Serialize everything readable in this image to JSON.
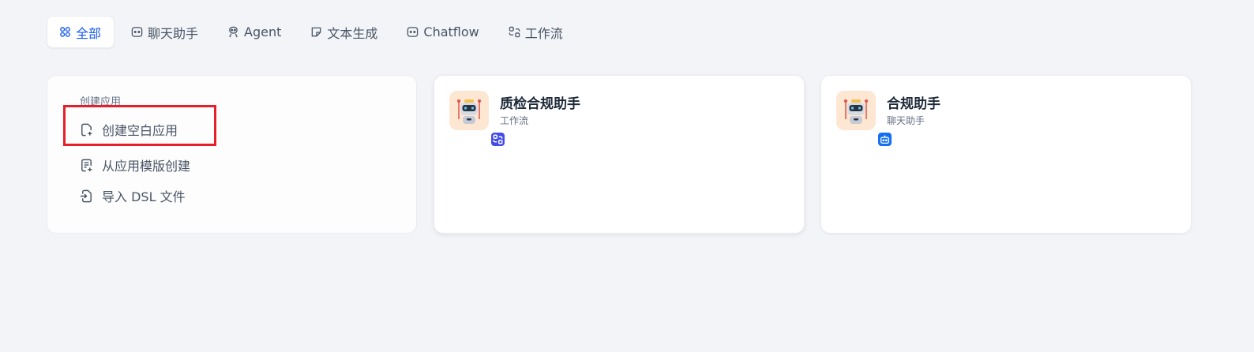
{
  "tabs": [
    {
      "label": "全部",
      "icon": "grid-icon",
      "active": true
    },
    {
      "label": "聊天助手",
      "icon": "chat-bubble-icon",
      "active": false
    },
    {
      "label": "Agent",
      "icon": "agent-icon",
      "active": false
    },
    {
      "label": "文本生成",
      "icon": "document-icon",
      "active": false
    },
    {
      "label": "Chatflow",
      "icon": "chatflow-icon",
      "active": false
    },
    {
      "label": "工作流",
      "icon": "workflow-icon",
      "active": false
    }
  ],
  "create": {
    "title": "创建应用",
    "items": [
      {
        "label": "创建空白应用",
        "icon": "file-plus-icon"
      },
      {
        "label": "从应用模版创建",
        "icon": "file-template-icon"
      },
      {
        "label": "导入 DSL 文件",
        "icon": "file-import-icon"
      }
    ]
  },
  "apps": [
    {
      "name": "质检合规助手",
      "type": "工作流",
      "badge": "workflow-icon"
    },
    {
      "name": "合规助手",
      "type": "聊天助手",
      "badge": "chat-bot-icon"
    }
  ],
  "colors": {
    "accent": "#155aef",
    "highlight": "#e5202a",
    "workflow_badge": "#444ce7",
    "chat_badge": "#1570ef"
  }
}
